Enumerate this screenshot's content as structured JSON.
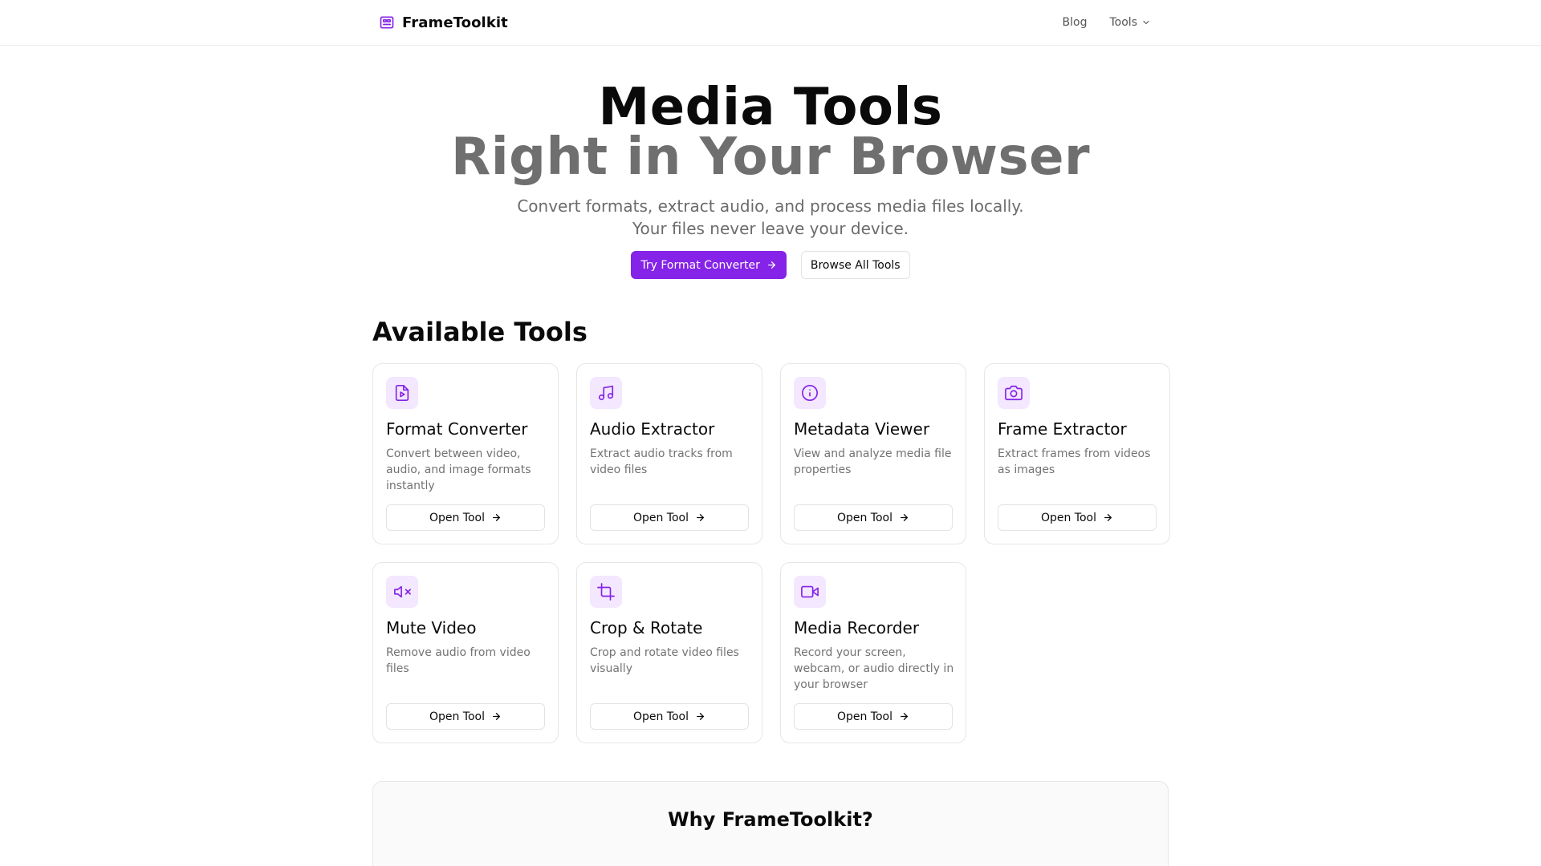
{
  "header": {
    "brand": "FrameToolkit",
    "nav": {
      "blog": "Blog",
      "tools": "Tools"
    }
  },
  "hero": {
    "title_line1": "Media Tools",
    "title_line2": "Right in Your Browser",
    "subtitle_line1": "Convert formats, extract audio, and process media files locally.",
    "subtitle_line2": "Your files never leave your device.",
    "primary_button": "Try Format Converter",
    "secondary_button": "Browse All Tools"
  },
  "tools_section": {
    "title": "Available Tools",
    "open_label": "Open Tool",
    "items": [
      {
        "title": "Format Converter",
        "description": "Convert between video, audio, and image formats instantly",
        "icon": "file-video-icon"
      },
      {
        "title": "Audio Extractor",
        "description": "Extract audio tracks from video files",
        "icon": "music-icon"
      },
      {
        "title": "Metadata Viewer",
        "description": "View and analyze media file properties",
        "icon": "info-icon"
      },
      {
        "title": "Frame Extractor",
        "description": "Extract frames from videos as images",
        "icon": "camera-icon"
      },
      {
        "title": "Mute Video",
        "description": "Remove audio from video files",
        "icon": "volume-x-icon"
      },
      {
        "title": "Crop & Rotate",
        "description": "Crop and rotate video files visually",
        "icon": "crop-icon"
      },
      {
        "title": "Media Recorder",
        "description": "Record your screen, webcam, or audio directly in your browser",
        "icon": "video-camera-icon"
      }
    ]
  },
  "why": {
    "title": "Why FrameToolkit?"
  },
  "colors": {
    "accent": "#8523e8",
    "icon_bg": "#f3e8ff",
    "muted_text": "#737373"
  }
}
